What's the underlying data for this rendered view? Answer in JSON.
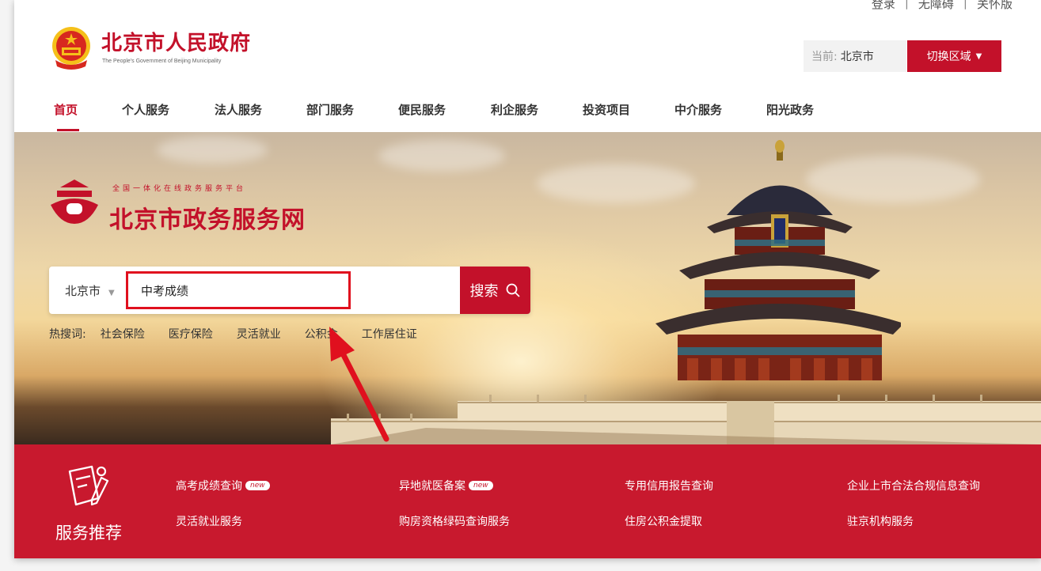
{
  "top_links": {
    "login": "登录",
    "accessibility": "无障碍",
    "care_mode": "关怀版"
  },
  "header": {
    "title": "北京市人民政府",
    "subtitle": "The People's Government of Beijing Municipality",
    "region_label": "当前:",
    "region_value": "北京市",
    "switch_region": "切换区域"
  },
  "nav": {
    "items": [
      {
        "label": "首页"
      },
      {
        "label": "个人服务"
      },
      {
        "label": "法人服务"
      },
      {
        "label": "部门服务"
      },
      {
        "label": "便民服务"
      },
      {
        "label": "利企服务"
      },
      {
        "label": "投资项目"
      },
      {
        "label": "中介服务"
      },
      {
        "label": "阳光政务"
      }
    ],
    "active_index": 0
  },
  "banner": {
    "platform_tagline": "全国一体化在线政务服务平台",
    "platform_name": "北京市政务服务网"
  },
  "search": {
    "scope": "北京市",
    "value": "中考成绩",
    "button_label": "搜索"
  },
  "hot_search": {
    "label": "热搜词:",
    "items": [
      "社会保险",
      "医疗保险",
      "灵活就业",
      "公积金",
      "工作居住证"
    ]
  },
  "recommend": {
    "title": "服务推荐",
    "badge": "new",
    "links": [
      {
        "label": "高考成绩查询",
        "is_new": true
      },
      {
        "label": "异地就医备案",
        "is_new": true
      },
      {
        "label": "专用信用报告查询",
        "is_new": false
      },
      {
        "label": "企业上市合法合规信息查询",
        "is_new": false
      },
      {
        "label": "灵活就业服务",
        "is_new": false
      },
      {
        "label": "购房资格绿码查询服务",
        "is_new": false
      },
      {
        "label": "住房公积金提取",
        "is_new": false
      },
      {
        "label": "驻京机构服务",
        "is_new": false
      }
    ]
  },
  "colors": {
    "brand_red": "#c3112a",
    "highlight_box": "#e0101e"
  }
}
